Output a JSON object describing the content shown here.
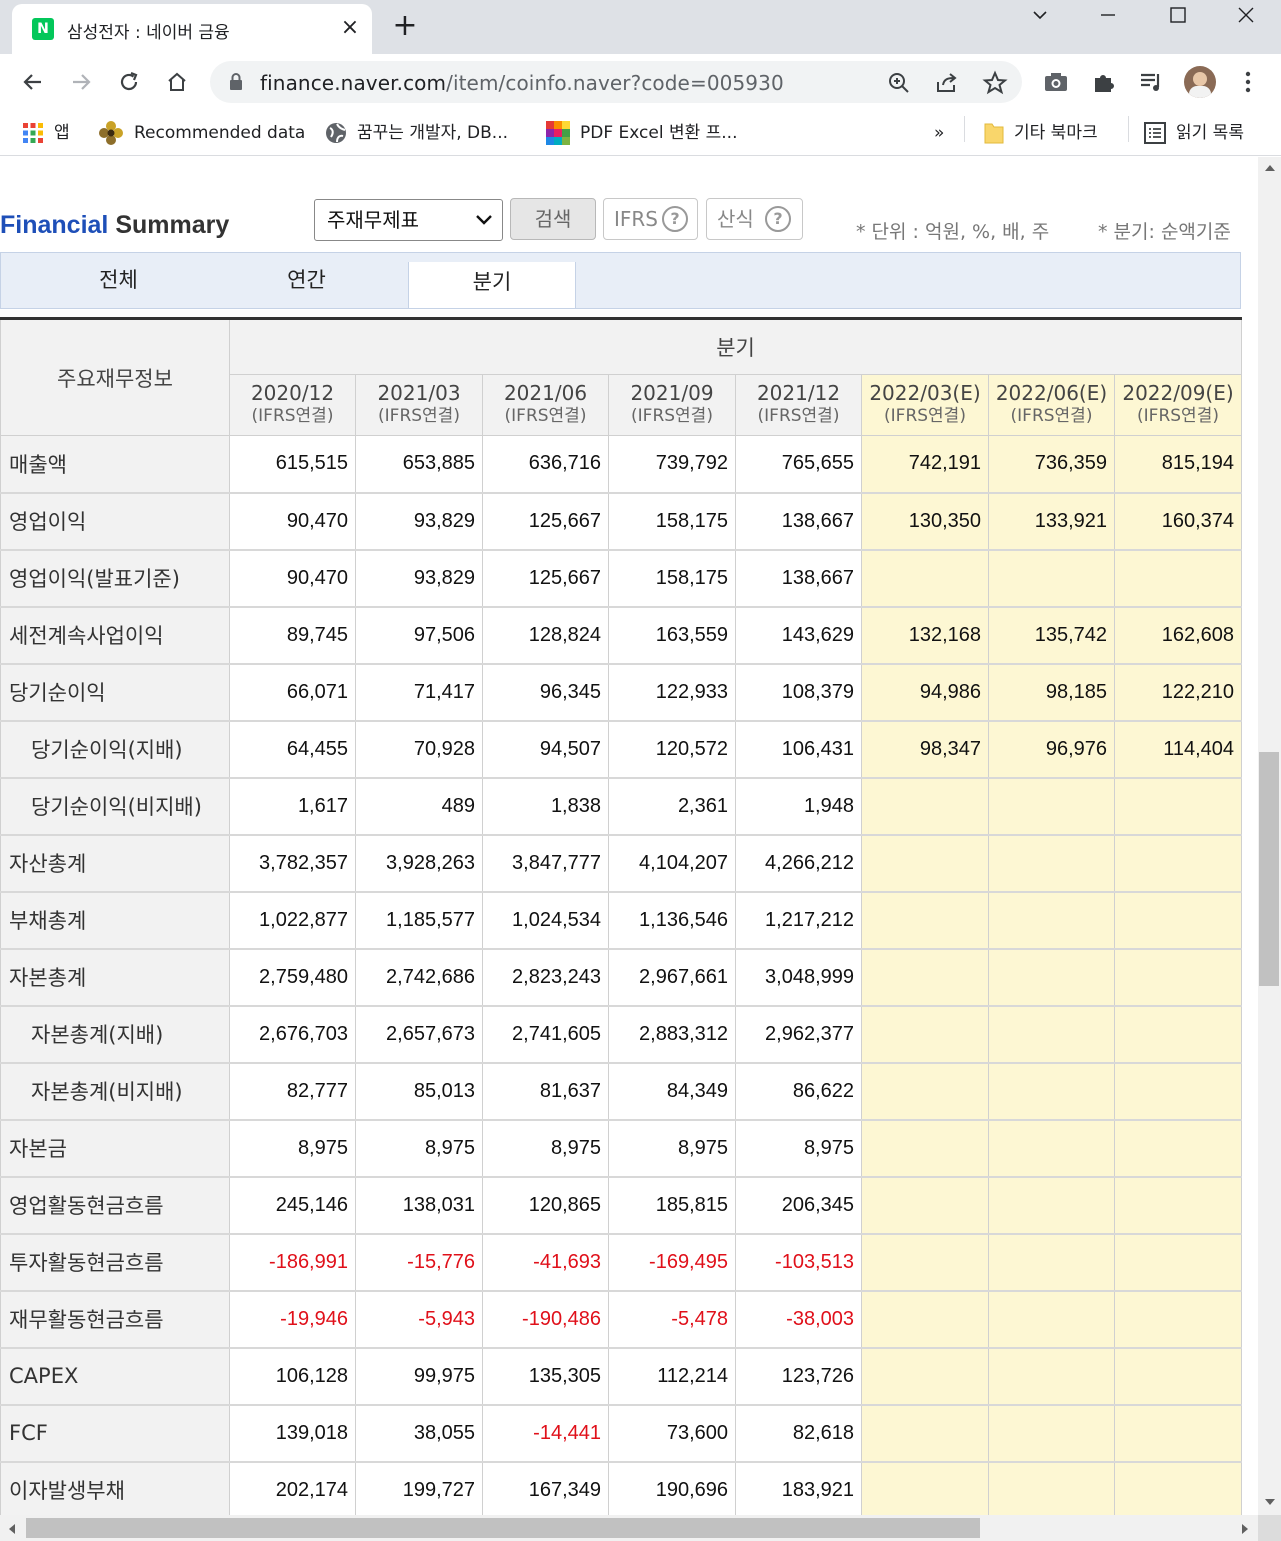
{
  "browser": {
    "tab_title": "삼성전자 : 네이버 금융",
    "tab_favicon": "N",
    "url_host": "finance.naver.com",
    "url_path": "/item/coinfo.naver?code=005930",
    "bookmarks": [
      {
        "label": "앱",
        "icon": "apps-grid-icon"
      },
      {
        "label": "Recommended data",
        "icon": "flower-icon"
      },
      {
        "label": "꿈꾸는 개발자, DB...",
        "icon": "globe-icon"
      },
      {
        "label": "PDF Excel 변환 프...",
        "icon": "colorful-squares-icon"
      }
    ],
    "bookmarks_overflow": "»",
    "other_bookmarks": "기타 북마크",
    "reading_list": "읽기 목록"
  },
  "page": {
    "title_blue": "Financial",
    "title_dark": " Summary",
    "select_value": "주재무제표",
    "search_button": "검색",
    "ifrs_button": "IFRS",
    "formula_button": "산식",
    "help_mark": "?",
    "unit_note": "* 단위 : 억원, %, 배, 주",
    "quarter_note": "* 분기: 순액기준",
    "tabs": [
      "전체",
      "연간",
      "분기"
    ],
    "colors": {
      "brand_blue": "#1e4fb8",
      "estimate_bg": "#fdf7d3",
      "negative": "#e0101a"
    }
  },
  "table": {
    "corner_header": "주요재무정보",
    "group_header": "분기",
    "periods": [
      {
        "date": "2020/12",
        "basis": "(IFRS연결)"
      },
      {
        "date": "2021/03",
        "basis": "(IFRS연결)"
      },
      {
        "date": "2021/06",
        "basis": "(IFRS연결)"
      },
      {
        "date": "2021/09",
        "basis": "(IFRS연결)"
      },
      {
        "date": "2021/12",
        "basis": "(IFRS연결)"
      },
      {
        "date": "2022/03(E)",
        "basis": "(IFRS연결)"
      },
      {
        "date": "2022/06(E)",
        "basis": "(IFRS연결)"
      },
      {
        "date": "2022/09(E)",
        "basis": "(IFRS연결)"
      }
    ],
    "rows": [
      {
        "label": "매출액",
        "indent": false,
        "values": [
          "615,515",
          "653,885",
          "636,716",
          "739,792",
          "765,655",
          "742,191",
          "736,359",
          "815,194"
        ]
      },
      {
        "label": "영업이익",
        "indent": false,
        "values": [
          "90,470",
          "93,829",
          "125,667",
          "158,175",
          "138,667",
          "130,350",
          "133,921",
          "160,374"
        ]
      },
      {
        "label": "영업이익(발표기준)",
        "indent": false,
        "values": [
          "90,470",
          "93,829",
          "125,667",
          "158,175",
          "138,667",
          "",
          "",
          ""
        ]
      },
      {
        "label": "세전계속사업이익",
        "indent": false,
        "values": [
          "89,745",
          "97,506",
          "128,824",
          "163,559",
          "143,629",
          "132,168",
          "135,742",
          "162,608"
        ]
      },
      {
        "label": "당기순이익",
        "indent": false,
        "values": [
          "66,071",
          "71,417",
          "96,345",
          "122,933",
          "108,379",
          "94,986",
          "98,185",
          "122,210"
        ]
      },
      {
        "label": "당기순이익(지배)",
        "indent": true,
        "values": [
          "64,455",
          "70,928",
          "94,507",
          "120,572",
          "106,431",
          "98,347",
          "96,976",
          "114,404"
        ]
      },
      {
        "label": "당기순이익(비지배)",
        "indent": true,
        "values": [
          "1,617",
          "489",
          "1,838",
          "2,361",
          "1,948",
          "",
          "",
          ""
        ]
      },
      {
        "label": "자산총계",
        "indent": false,
        "values": [
          "3,782,357",
          "3,928,263",
          "3,847,777",
          "4,104,207",
          "4,266,212",
          "",
          "",
          ""
        ]
      },
      {
        "label": "부채총계",
        "indent": false,
        "values": [
          "1,022,877",
          "1,185,577",
          "1,024,534",
          "1,136,546",
          "1,217,212",
          "",
          "",
          ""
        ]
      },
      {
        "label": "자본총계",
        "indent": false,
        "values": [
          "2,759,480",
          "2,742,686",
          "2,823,243",
          "2,967,661",
          "3,048,999",
          "",
          "",
          ""
        ]
      },
      {
        "label": "자본총계(지배)",
        "indent": true,
        "values": [
          "2,676,703",
          "2,657,673",
          "2,741,605",
          "2,883,312",
          "2,962,377",
          "",
          "",
          ""
        ]
      },
      {
        "label": "자본총계(비지배)",
        "indent": true,
        "values": [
          "82,777",
          "85,013",
          "81,637",
          "84,349",
          "86,622",
          "",
          "",
          ""
        ]
      },
      {
        "label": "자본금",
        "indent": false,
        "values": [
          "8,975",
          "8,975",
          "8,975",
          "8,975",
          "8,975",
          "",
          "",
          ""
        ]
      },
      {
        "label": "영업활동현금흐름",
        "indent": false,
        "values": [
          "245,146",
          "138,031",
          "120,865",
          "185,815",
          "206,345",
          "",
          "",
          ""
        ]
      },
      {
        "label": "투자활동현금흐름",
        "indent": false,
        "values": [
          "-186,991",
          "-15,776",
          "-41,693",
          "-169,495",
          "-103,513",
          "",
          "",
          ""
        ]
      },
      {
        "label": "재무활동현금흐름",
        "indent": false,
        "values": [
          "-19,946",
          "-5,943",
          "-190,486",
          "-5,478",
          "-38,003",
          "",
          "",
          ""
        ]
      },
      {
        "label": "CAPEX",
        "indent": false,
        "values": [
          "106,128",
          "99,975",
          "135,305",
          "112,214",
          "123,726",
          "",
          "",
          ""
        ]
      },
      {
        "label": "FCF",
        "indent": false,
        "values": [
          "139,018",
          "38,055",
          "-14,441",
          "73,600",
          "82,618",
          "",
          "",
          ""
        ]
      },
      {
        "label": "이자발생부채",
        "indent": false,
        "values": [
          "202,174",
          "199,727",
          "167,349",
          "190,696",
          "183,921",
          "",
          "",
          ""
        ]
      }
    ]
  }
}
